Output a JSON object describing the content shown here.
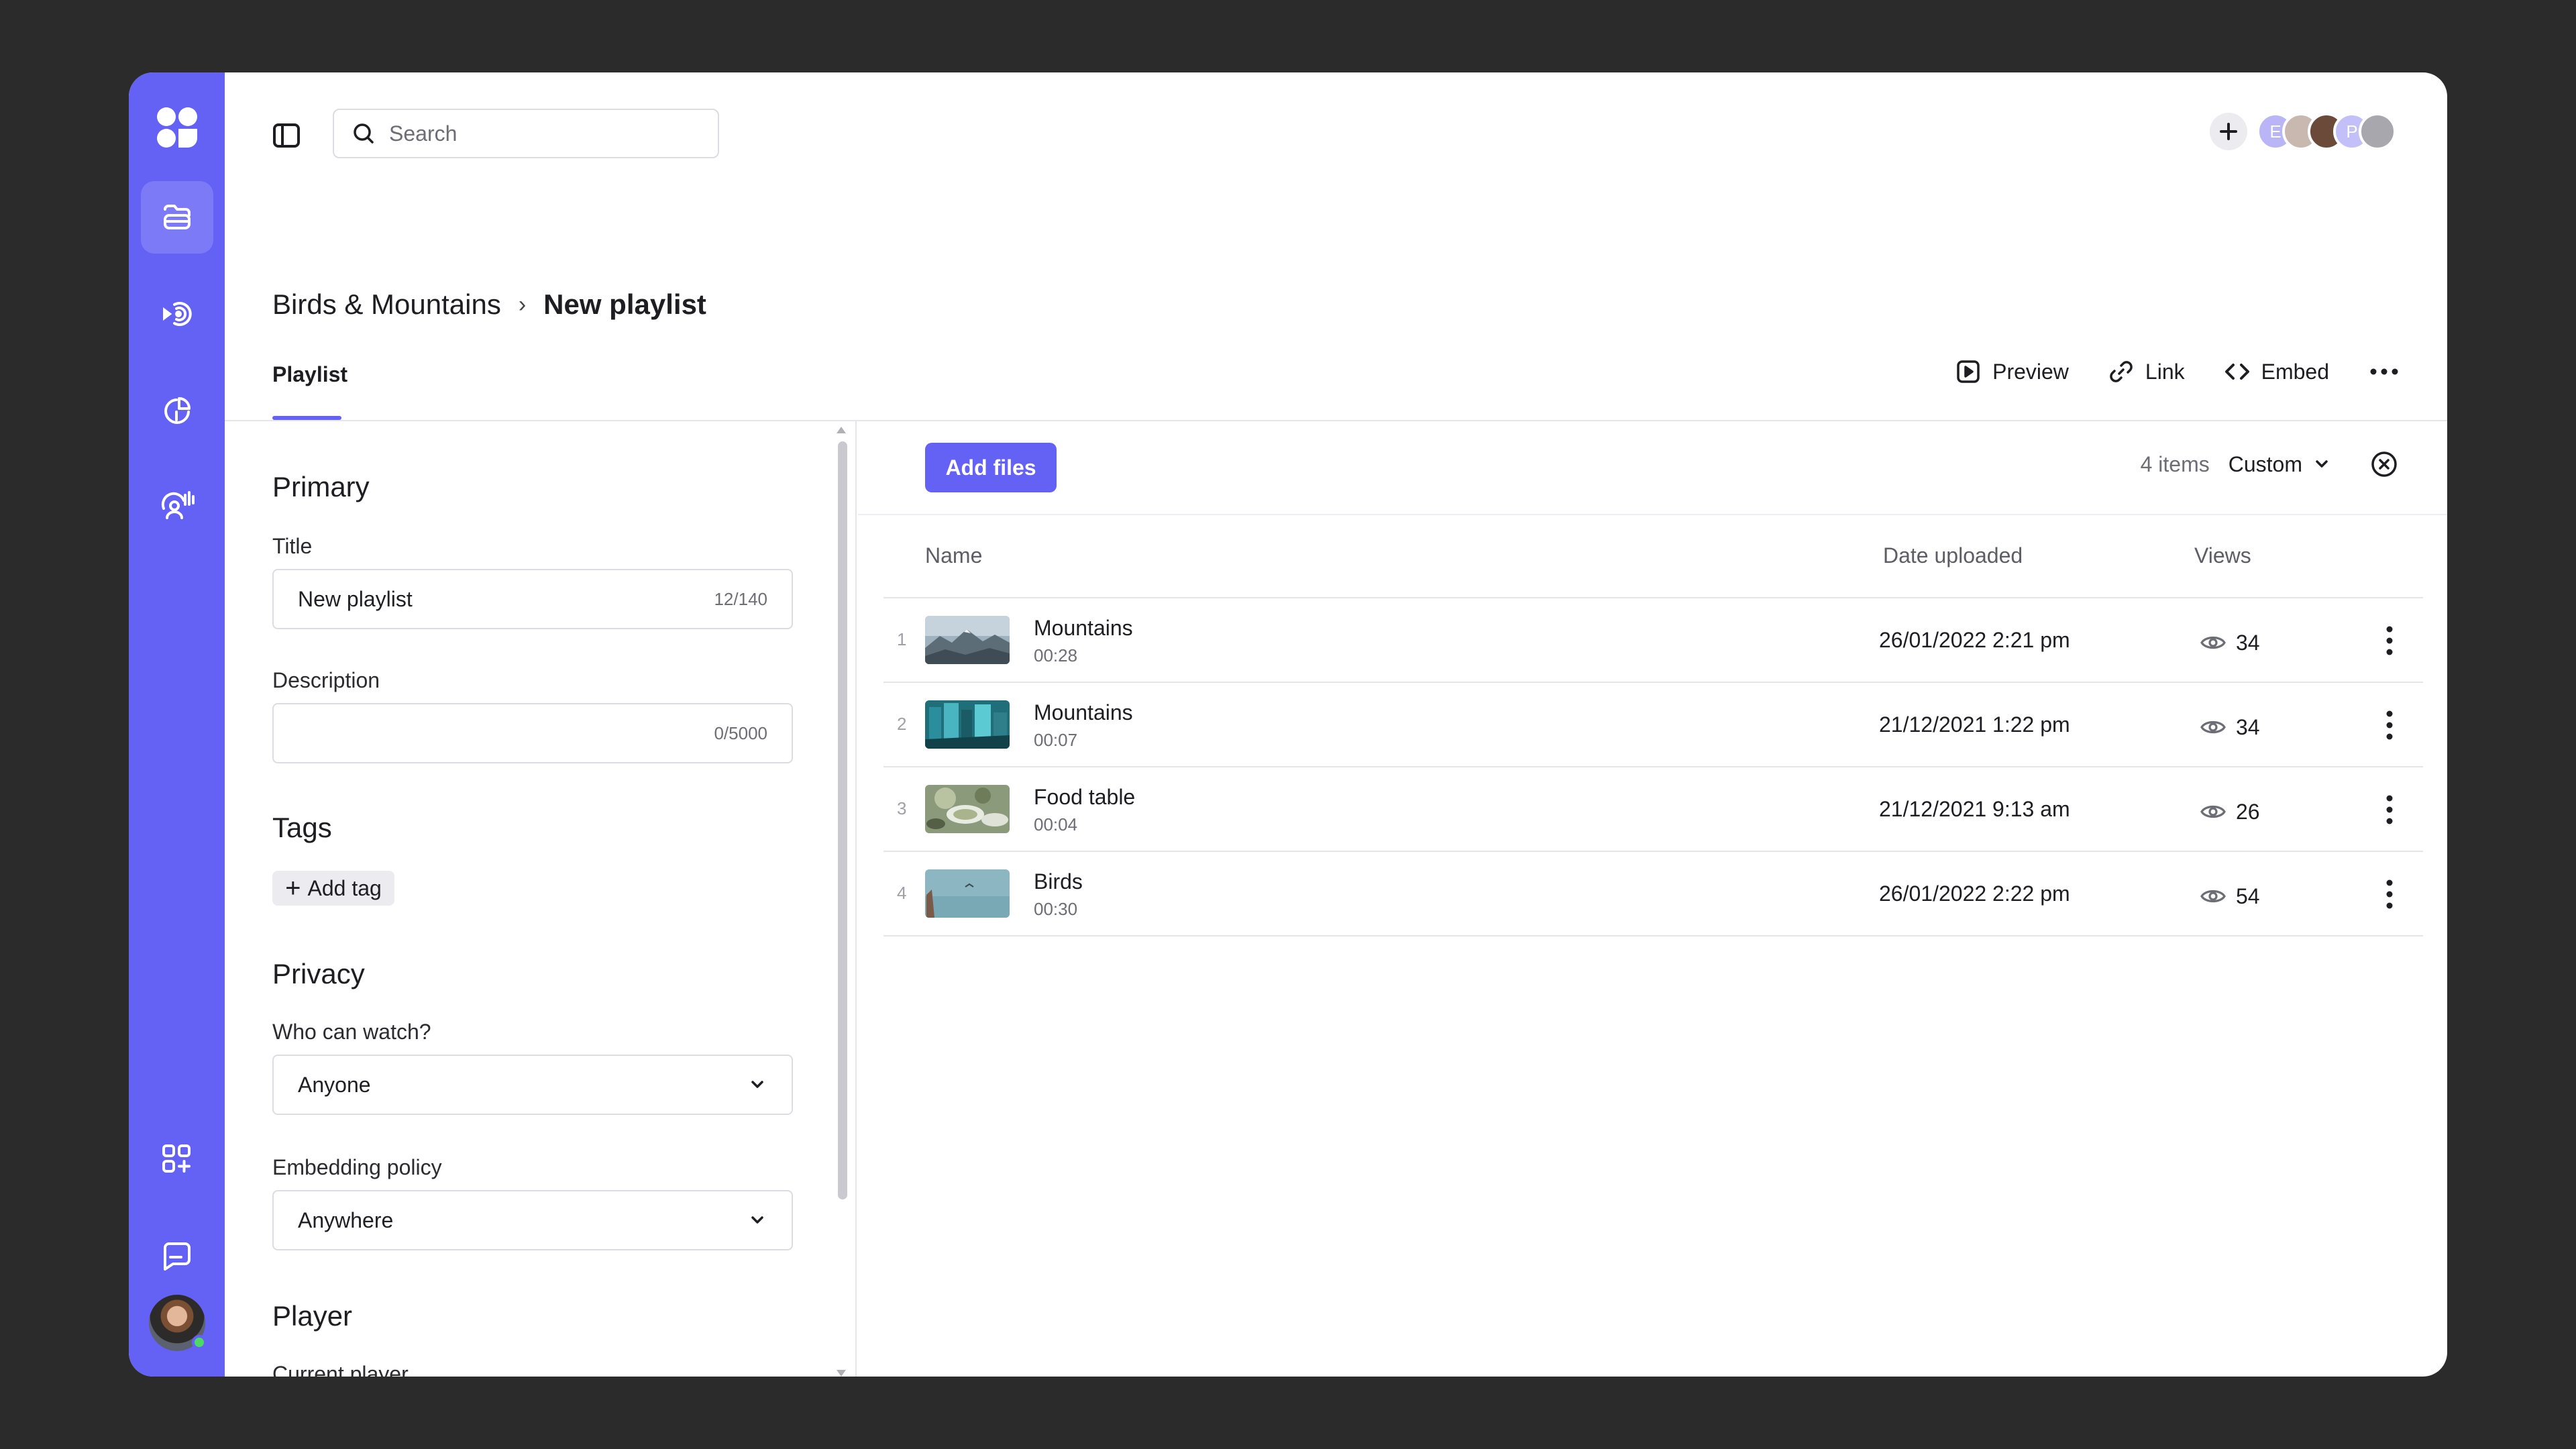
{
  "search": {
    "placeholder": "Search"
  },
  "header": {
    "avatars": [
      {
        "initial": "E",
        "color": "#b9b5f7"
      },
      {
        "initial": "",
        "color": "#c9b8b0"
      },
      {
        "initial": "",
        "color": "#6b4a3a"
      },
      {
        "initial": "P",
        "color": "#c3c0f9"
      },
      {
        "initial": "",
        "color": "#a7a7ad"
      }
    ]
  },
  "breadcrumb": {
    "root": "Birds & Mountains",
    "separator": "›",
    "current": "New playlist"
  },
  "tabs": {
    "playlist": "Playlist"
  },
  "actions": {
    "preview": "Preview",
    "link": "Link",
    "embed": "Embed"
  },
  "panel": {
    "primary": "Primary",
    "title_label": "Title",
    "title_value": "New playlist",
    "title_counter": "12/140",
    "description_label": "Description",
    "description_value": "",
    "description_counter": "0/5000",
    "tags": "Tags",
    "add_tag": "Add tag",
    "privacy": "Privacy",
    "who_label": "Who can watch?",
    "who_value": "Anyone",
    "embedding_label": "Embedding policy",
    "embedding_value": "Anywhere",
    "player": "Player",
    "current_player_label": "Current player",
    "current_player_value": ""
  },
  "content": {
    "add_files": "Add files",
    "items_count": "4 items",
    "sort": "Custom",
    "columns": {
      "name": "Name",
      "date": "Date uploaded",
      "views": "Views"
    },
    "rows": [
      {
        "index": "1",
        "title": "Mountains",
        "duration": "00:28",
        "date": "26/01/2022 2:21 pm",
        "views": "34",
        "thumb": "mountains"
      },
      {
        "index": "2",
        "title": "Mountains",
        "duration": "00:07",
        "date": "21/12/2021 1:22 pm",
        "views": "34",
        "thumb": "city"
      },
      {
        "index": "3",
        "title": "Food table",
        "duration": "00:04",
        "date": "21/12/2021 9:13 am",
        "views": "26",
        "thumb": "food"
      },
      {
        "index": "4",
        "title": "Birds",
        "duration": "00:30",
        "date": "26/01/2022 2:22 pm",
        "views": "54",
        "thumb": "birds"
      }
    ]
  },
  "colors": {
    "accent": "#6461f5",
    "background": "#2b2b2b"
  },
  "icons": [
    "logo-icon",
    "folder-icon",
    "broadcast-icon",
    "analytics-icon",
    "contacts-icon",
    "apps-icon",
    "chat-icon",
    "sidebar-toggle-icon",
    "search-icon",
    "plus-icon",
    "preview-icon",
    "link-icon",
    "embed-icon",
    "more-horizontal-icon",
    "chevron-down-icon",
    "close-circle-icon",
    "eye-icon",
    "more-vertical-icon"
  ]
}
